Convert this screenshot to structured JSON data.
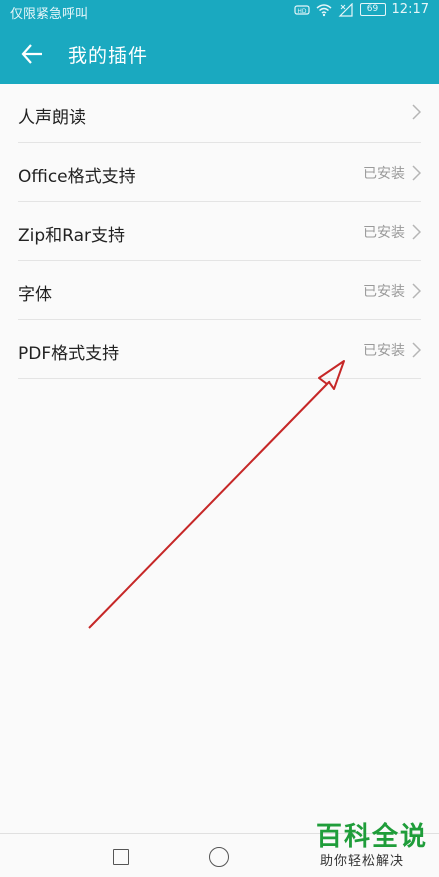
{
  "status_bar": {
    "carrier_text": "仅限紧急呼叫",
    "battery": "69",
    "time": "12:17"
  },
  "header": {
    "title": "我的插件"
  },
  "plugins": [
    {
      "label": "人声朗读",
      "status": ""
    },
    {
      "label": "Office格式支持",
      "status": "已安装"
    },
    {
      "label": "Zip和Rar支持",
      "status": "已安装"
    },
    {
      "label": "字体",
      "status": "已安装"
    },
    {
      "label": "PDF格式支持",
      "status": "已安装"
    }
  ],
  "watermark": {
    "title": "百科全说",
    "subtitle": "助你轻松解决"
  },
  "colors": {
    "accent": "#1aa9c0",
    "annotation_arrow": "#c62828",
    "watermark_green": "#1f9d3a"
  },
  "icons": [
    "back-arrow-icon",
    "wifi-icon",
    "signal-icon",
    "battery-icon",
    "chevron-right-icon",
    "recent-apps-icon",
    "home-icon"
  ]
}
